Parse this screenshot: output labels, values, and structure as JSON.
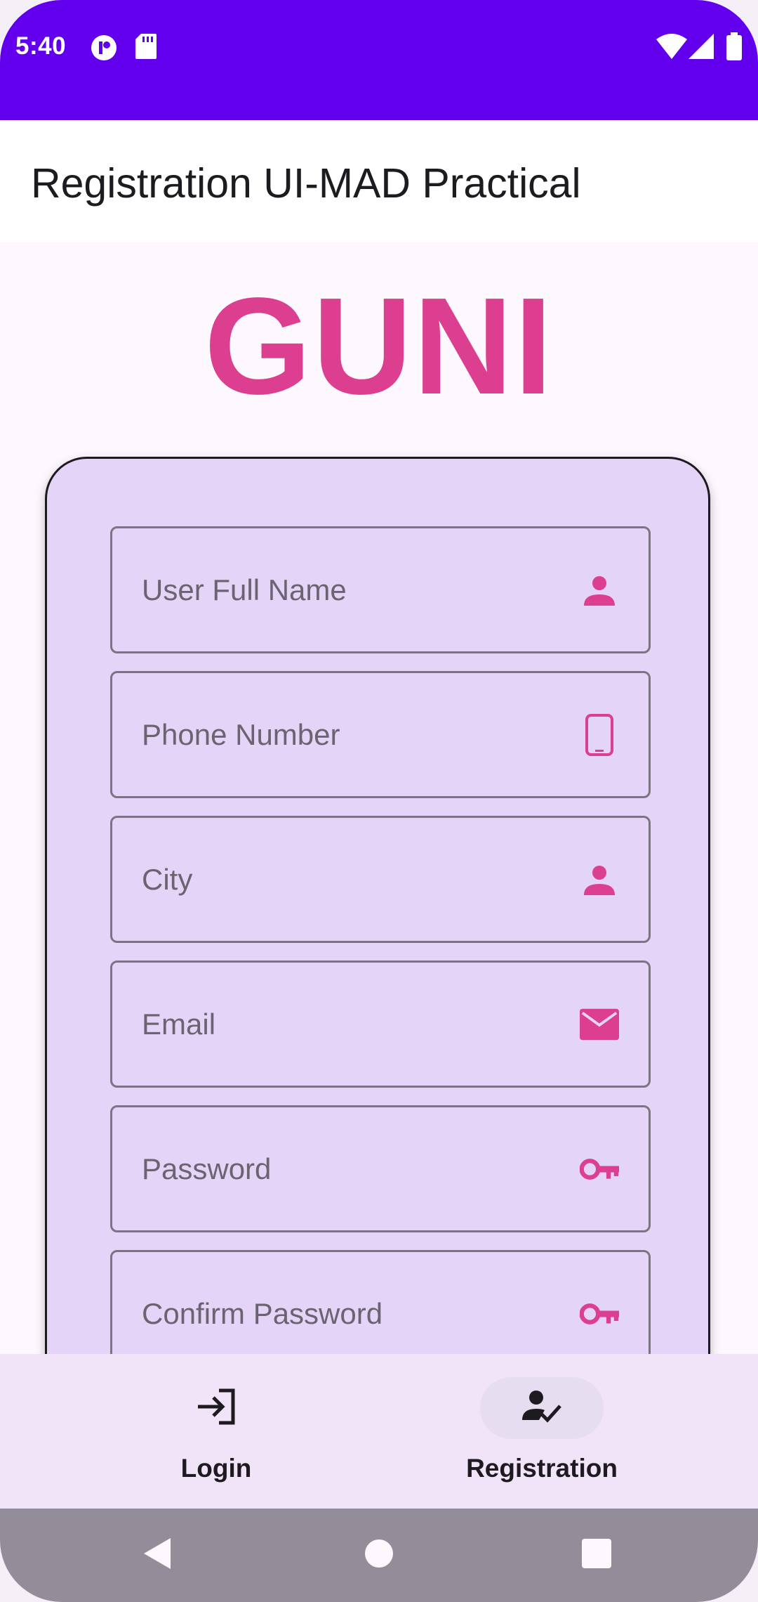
{
  "status_bar": {
    "time": "5:40",
    "background": "#6200ee",
    "icons": [
      "app-notification-icon",
      "sd-card-icon",
      "wifi-icon",
      "signal-icon",
      "battery-icon"
    ]
  },
  "app_bar": {
    "title": "Registration UI-MAD Practical"
  },
  "logo": {
    "text": "GUNI",
    "color": "#dc3f8f"
  },
  "form": {
    "fields": [
      {
        "placeholder": "User Full Name",
        "icon": "person-icon"
      },
      {
        "placeholder": "Phone Number",
        "icon": "phone-icon"
      },
      {
        "placeholder": "City",
        "icon": "person-icon"
      },
      {
        "placeholder": "Email",
        "icon": "mail-icon"
      },
      {
        "placeholder": "Password",
        "icon": "key-icon"
      },
      {
        "placeholder": "Confirm Password",
        "icon": "key-icon"
      }
    ],
    "icon_color": "#dc3f8f"
  },
  "bottom_nav": {
    "items": [
      {
        "label": "Login",
        "icon": "login-icon",
        "selected": false
      },
      {
        "label": "Registration",
        "icon": "how-to-reg-icon",
        "selected": true
      }
    ]
  },
  "system_nav": {
    "buttons": [
      "back-icon",
      "home-icon",
      "recents-icon"
    ]
  }
}
